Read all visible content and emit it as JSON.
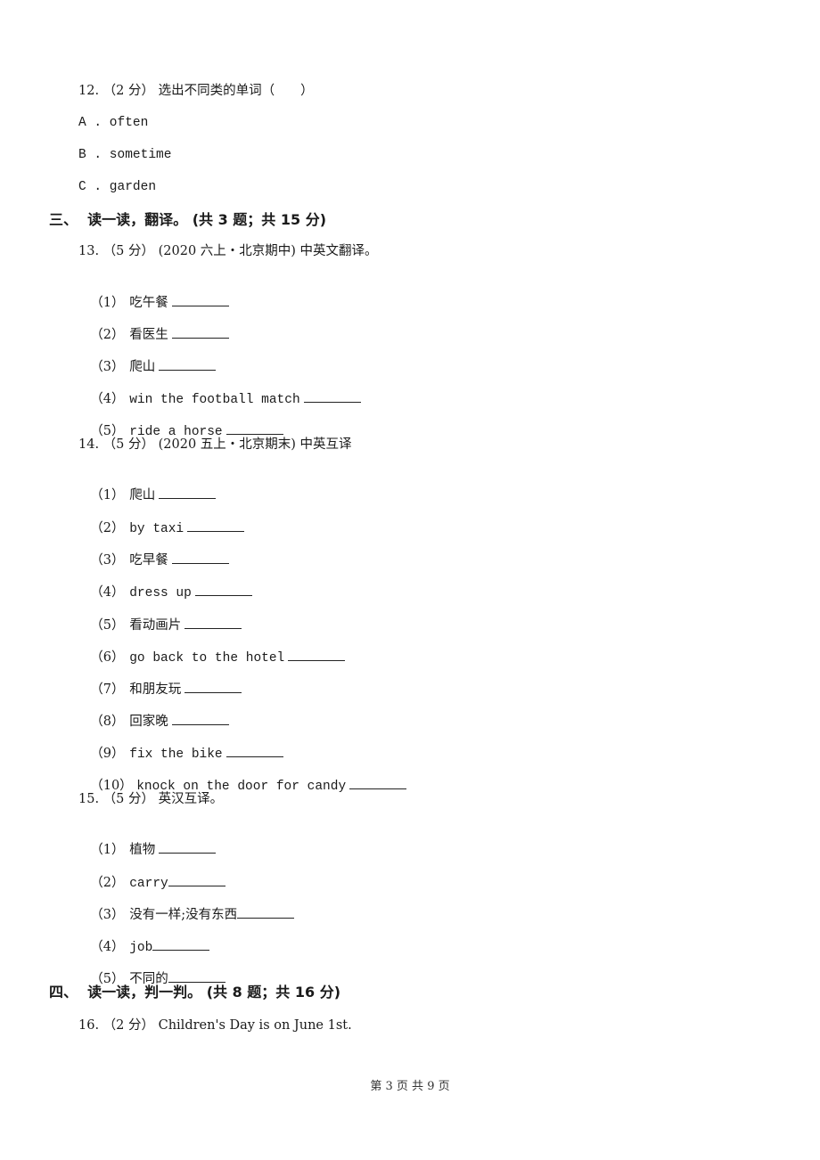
{
  "q12": {
    "stem": "12. （2 分） 选出不同类的单词（　　）",
    "options": [
      "A . often",
      "B . sometime",
      "C . garden"
    ]
  },
  "section3": {
    "title": "三、  读一读，翻译。 (共 3 题；共 15 分)"
  },
  "q13": {
    "stem": "13. （5 分） (2020 六上・北京期中) 中英文翻译。",
    "items": [
      {
        "num": "（1）",
        "text": "吃午餐"
      },
      {
        "num": "（2）",
        "text": "看医生"
      },
      {
        "num": "（3）",
        "text": "爬山"
      },
      {
        "num": "（4）",
        "text": "win the football match"
      },
      {
        "num": "（5）",
        "text": "ride a horse"
      }
    ]
  },
  "q14": {
    "stem": "14. （5 分） (2020 五上・北京期末) 中英互译",
    "items": [
      {
        "num": "（1）",
        "text": "爬山"
      },
      {
        "num": "（2）",
        "text": "by taxi"
      },
      {
        "num": "（3）",
        "text": "吃早餐"
      },
      {
        "num": "（4）",
        "text": "dress up"
      },
      {
        "num": "（5）",
        "text": "看动画片"
      },
      {
        "num": "（6）",
        "text": "go back to the hotel"
      },
      {
        "num": "（7）",
        "text": "和朋友玩"
      },
      {
        "num": "（8）",
        "text": "回家晚"
      },
      {
        "num": "（9）",
        "text": "fix the bike"
      },
      {
        "num": "（10）",
        "text": "knock on the door for candy"
      }
    ]
  },
  "q15": {
    "stem": "15. （5 分） 英汉互译。",
    "items": [
      {
        "num": "（1）",
        "text": "植物"
      },
      {
        "num": "（2）",
        "text": "carry"
      },
      {
        "num": "（3）",
        "text": "没有一样;没有东西"
      },
      {
        "num": "（4）",
        "text": "job"
      },
      {
        "num": "（5）",
        "text": "不同的"
      }
    ]
  },
  "section4": {
    "title": "四、  读一读，判一判。 (共 8 题；共 16 分)"
  },
  "q16": {
    "stem": "16. （2 分） Children's Day is on June 1st."
  },
  "footer": {
    "page_label": "第 3 页 共 9 页"
  }
}
